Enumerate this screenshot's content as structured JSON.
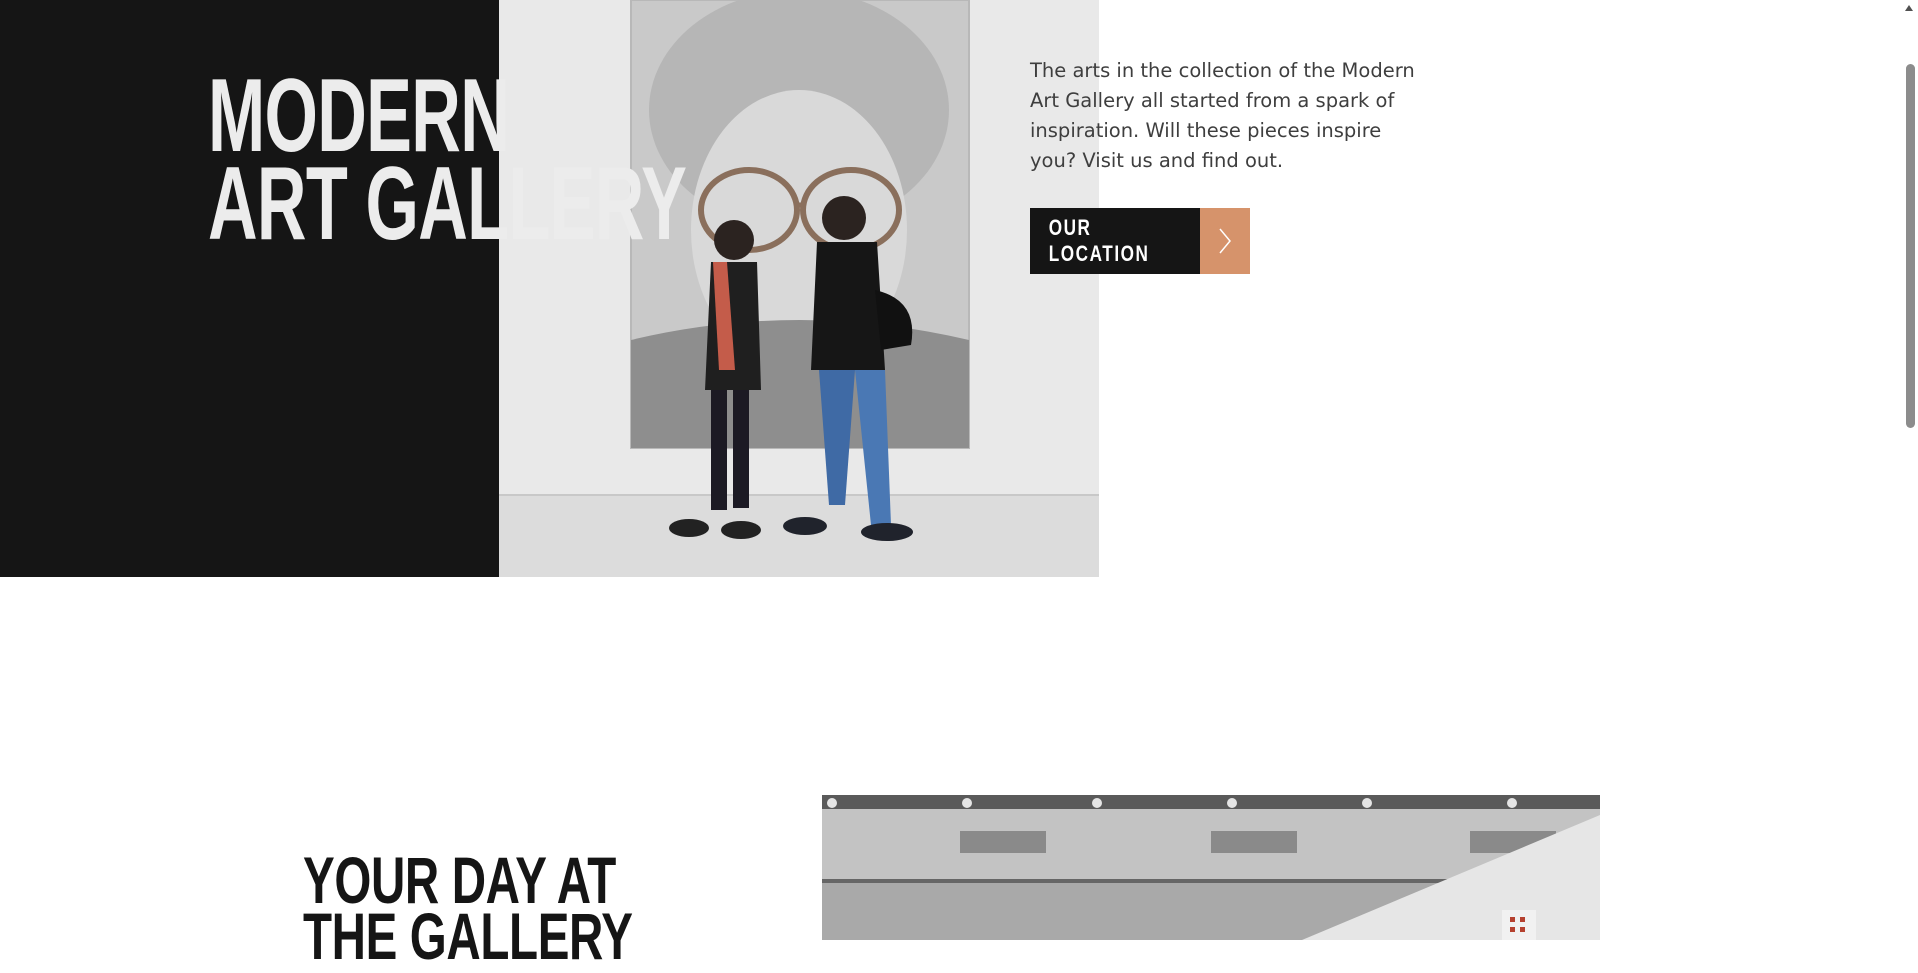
{
  "hero": {
    "title_line1": "MODERN",
    "title_line2": "ART GALLERY",
    "intro": "The arts in the collection of the Modern Art Gallery all started from a spark of inspiration. Will these pieces inspire you? Visit us and find out.",
    "cta_label": "OUR LOCATION",
    "cta_icon": "chevron-right-icon"
  },
  "section": {
    "title": "YOUR DAY AT THE GALLERY"
  },
  "colors": {
    "dark": "#151515",
    "accent": "#d6936b",
    "body_text": "#3e3e3e"
  },
  "scrollbar": {
    "icon": "scroll-up-arrow-icon"
  }
}
